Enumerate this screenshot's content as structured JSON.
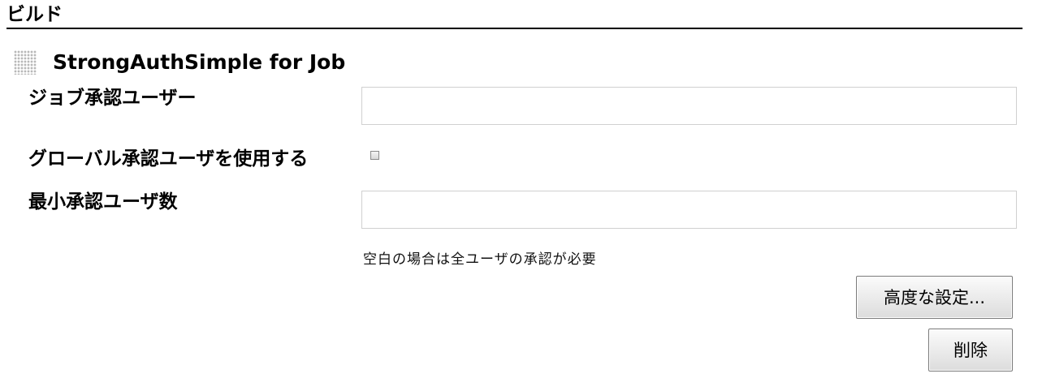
{
  "section": {
    "title": "ビルド"
  },
  "step": {
    "title": "StrongAuthSimple for Job",
    "handle_icon": "drag-handle-icon"
  },
  "fields": {
    "job_approver": {
      "label": "ジョブ承認ユーザー",
      "value": "",
      "placeholder": ""
    },
    "use_global_approver": {
      "label": "グローバル承認ユーザを使用する",
      "checked": false
    },
    "min_approvers": {
      "label": "最小承認ユーザ数",
      "value": "",
      "placeholder": "",
      "help": "空白の場合は全ユーザの承認が必要"
    }
  },
  "buttons": {
    "advanced_label": "高度な設定...",
    "delete_label": "削除"
  }
}
